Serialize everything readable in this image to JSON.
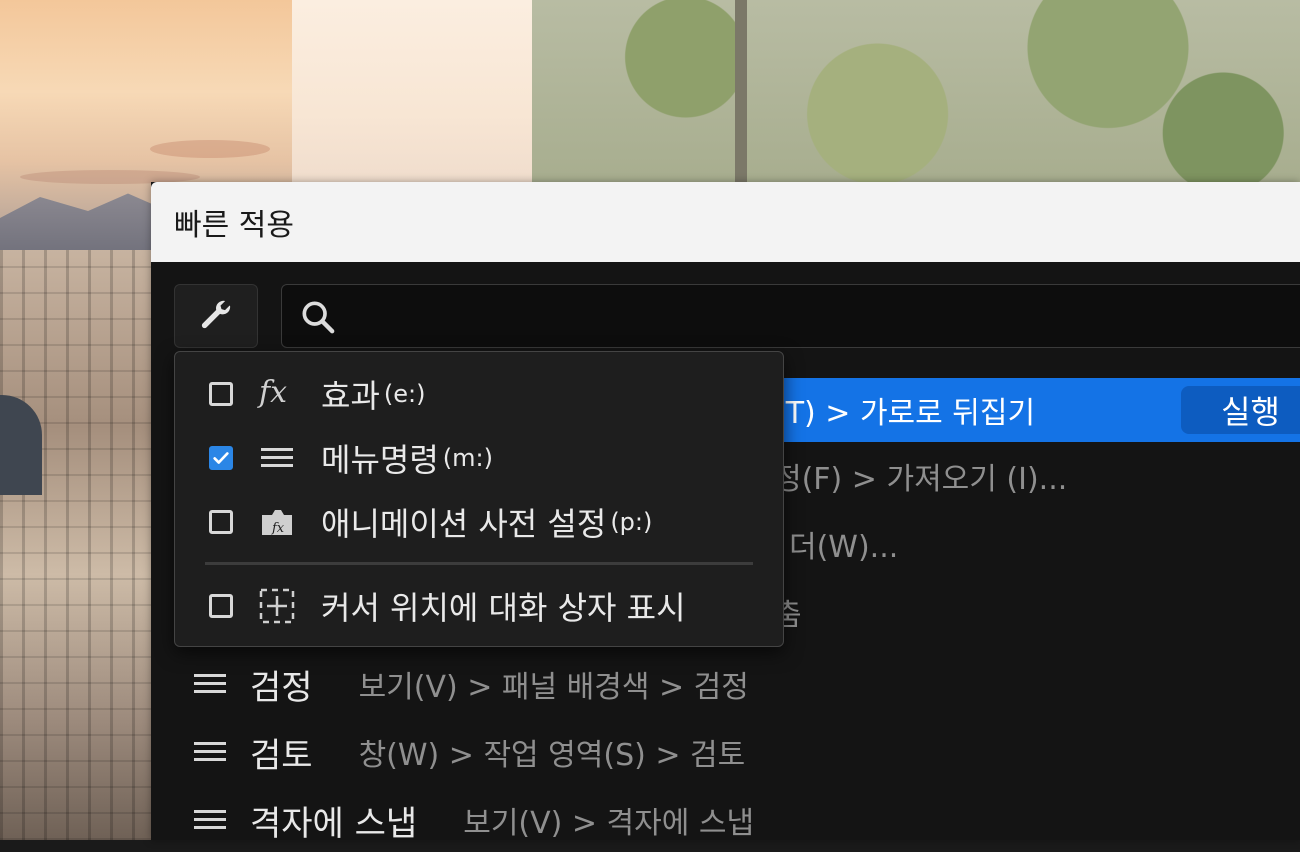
{
  "dialog": {
    "title": "빠른 적용",
    "search_placeholder": ""
  },
  "results": [
    {
      "name": "",
      "path": "(T) > 가로로 뒤집기",
      "selected": true,
      "action": "실행"
    },
    {
      "name": "",
      "path": "정(F) > 가져오기 (I)..."
    },
    {
      "name": "",
      "path": "더(W)..."
    },
    {
      "name": "",
      "path": "춤"
    },
    {
      "name": "검정",
      "path": "보기(V) > 패널 배경색 > 검정"
    },
    {
      "name": "검토",
      "path": "창(W) > 작업 영역(S) > 검토"
    },
    {
      "name": "격자에 스냅",
      "path": "보기(V) > 격자에 스냅"
    }
  ],
  "filter_menu": {
    "options": [
      {
        "label": "효과",
        "key": "(e:)",
        "checked": false,
        "icon": "fx-icon"
      },
      {
        "label": "메뉴명령",
        "key": "(m:)",
        "checked": true,
        "icon": "menu-icon"
      },
      {
        "label": "애니메이션 사전 설정",
        "key": "(p:)",
        "checked": false,
        "icon": "preset-icon"
      }
    ],
    "cursor_option": {
      "label": "커서 위치에 대화 상자 표시",
      "checked": false,
      "icon": "cursor-position-icon"
    }
  },
  "colors": {
    "accent": "#1473e6",
    "checkbox": "#2b86e6",
    "dialog_bg": "#141414"
  }
}
